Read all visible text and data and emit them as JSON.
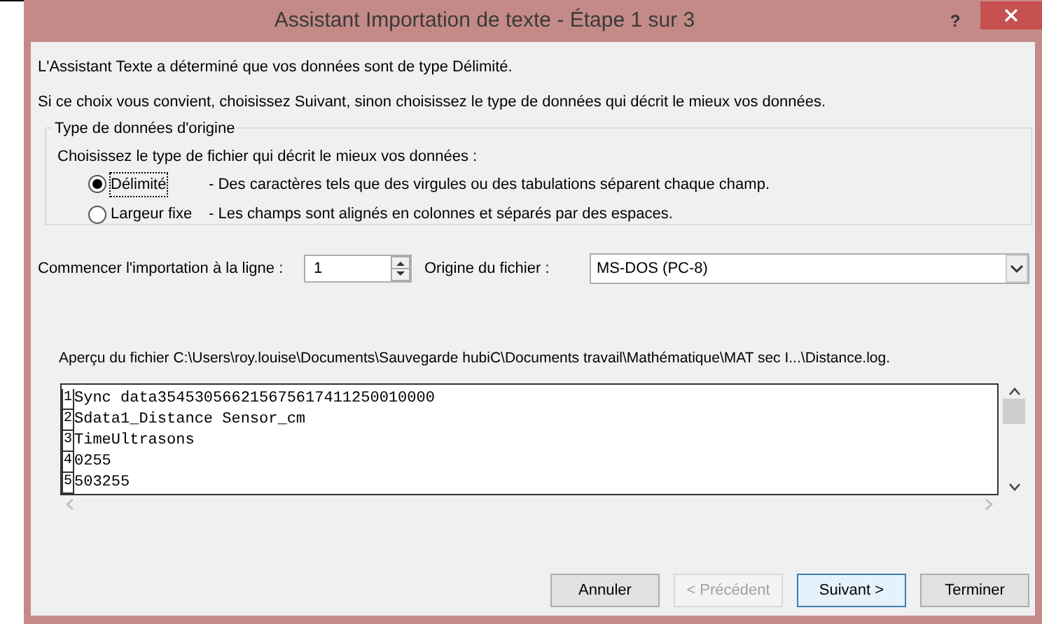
{
  "window": {
    "title": "Assistant Importation de texte - Étape 1 sur 3",
    "help": "?"
  },
  "intro": [
    "L'Assistant Texte a déterminé que vos données sont de type Délimité.",
    "Si ce choix vous convient, choisissez Suivant, sinon choisissez le type de données qui décrit le mieux vos données."
  ],
  "group": {
    "title": "Type de données d'origine",
    "prompt": "Choisissez le type de fichier qui décrit le mieux vos données :",
    "options": [
      {
        "label": "Délimité",
        "description": "- Des caractères tels que des virgules ou des tabulations séparent chaque champ.",
        "selected": true
      },
      {
        "label": "Largeur fixe",
        "description": "- Les champs sont alignés en colonnes et séparés par des espaces.",
        "selected": false
      }
    ]
  },
  "start_row": {
    "label": "Commencer l'importation à la ligne :",
    "value": "1"
  },
  "file_origin": {
    "label": "Origine du fichier :",
    "value": "MS-DOS (PC-8)"
  },
  "preview": {
    "label": "Aperçu du fichier C:\\Users\\roy.louise\\Documents\\Sauvegarde hubiC\\Documents travail\\Mathématique\\MAT sec I...\\Distance.log.",
    "rows": [
      {
        "number": "1",
        "text": "Sync data354530566215675617411250010000"
      },
      {
        "number": "2",
        "text": "Sdata1_Distance Sensor_cm"
      },
      {
        "number": "3",
        "text": "TimeUltrasons"
      },
      {
        "number": "4",
        "text": "0255"
      },
      {
        "number": "5",
        "text": "503255"
      }
    ]
  },
  "buttons": [
    {
      "label": "Annuler",
      "disabled": false,
      "default": false
    },
    {
      "label": "< Précédent",
      "disabled": true,
      "default": false
    },
    {
      "label": "Suivant >",
      "disabled": false,
      "default": true
    },
    {
      "label": "Terminer",
      "disabled": false,
      "default": false
    }
  ]
}
